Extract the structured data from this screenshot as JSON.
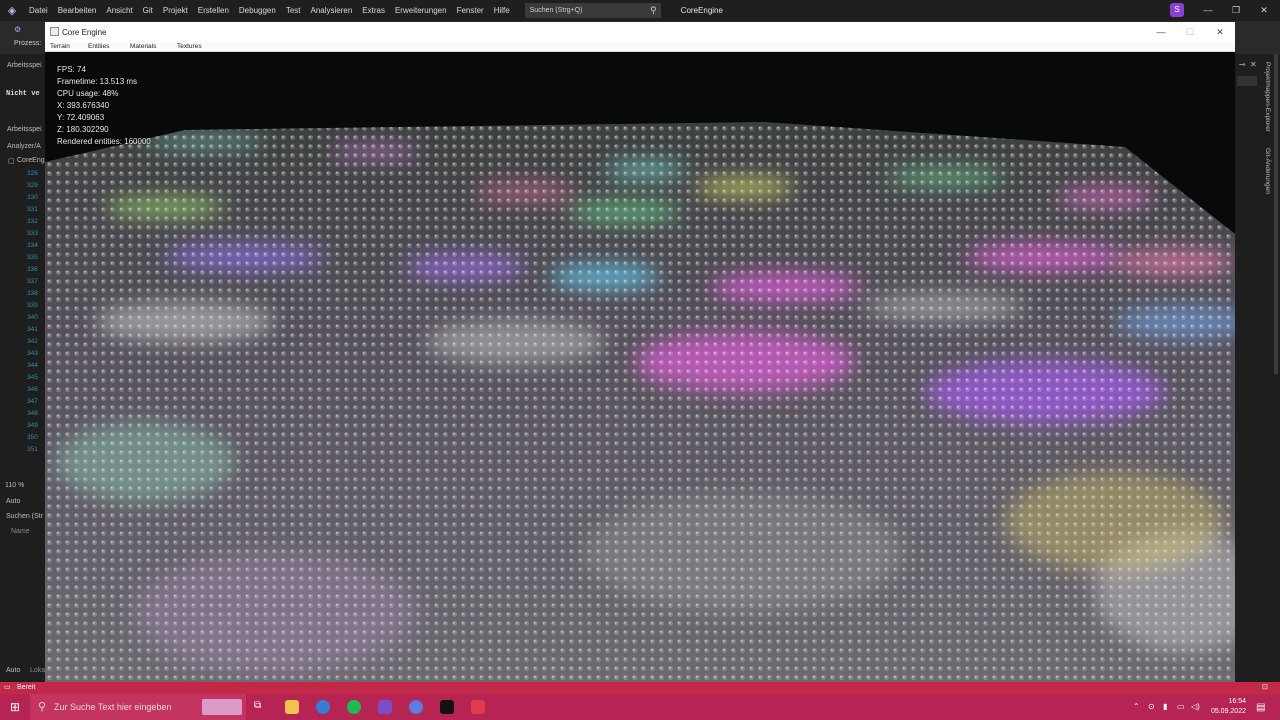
{
  "vs": {
    "menu": [
      "Datei",
      "Bearbeiten",
      "Ansicht",
      "Git",
      "Projekt",
      "Erstellen",
      "Debuggen",
      "Test",
      "Analysieren",
      "Extras",
      "Erweiterungen",
      "Fenster",
      "Hilfe"
    ],
    "search_placeholder": "Suchen (Strg+Q)",
    "solution_name": "CoreEngine",
    "account_initial": "S",
    "left_panel": {
      "prozess": "Prozess:",
      "arbeitsspeicher": "Arbeitsspei",
      "nicht": "Nicht ve",
      "arbeitsspeicher2": "Arbeitsspei",
      "analyzer": "Analyzer/A",
      "coreeng": "CoreEng",
      "line_numbers": [
        "326",
        "329",
        "330",
        "331",
        "332",
        "333",
        "334",
        "335",
        "336",
        "337",
        "338",
        "339",
        "340",
        "341",
        "342",
        "343",
        "344",
        "345",
        "346",
        "347",
        "348",
        "349",
        "350",
        "351"
      ],
      "zoom": "110 %",
      "auto1": "Auto",
      "suchen": "Suchen (Str",
      "name": "Name",
      "auto2": "Auto",
      "lokal": "Loka"
    },
    "right_panel": {
      "tab1": "Projektmappen-Explorer",
      "tab2": "Git-Änderungen"
    },
    "status": "Bereit",
    "colors": {
      "accent": "#c22948",
      "taskbar": "#b62454"
    }
  },
  "engine": {
    "title": "Core Engine",
    "menu": [
      "Terrain",
      "Entities",
      "Materials",
      "Textures"
    ],
    "hud": {
      "fps": "FPS: 74",
      "frametime": "Frametime: 13.513 ms",
      "cpu": "CPU usage: 48%",
      "x": "X: 393.676340",
      "y": "Y: 72.409063",
      "z": "Z: 180.302290",
      "rendered": "Rendered entities: 160000"
    }
  },
  "taskbar": {
    "search_placeholder": "Zur Suche Text hier eingeben",
    "time": "16:54",
    "date": "05.09.2022"
  }
}
